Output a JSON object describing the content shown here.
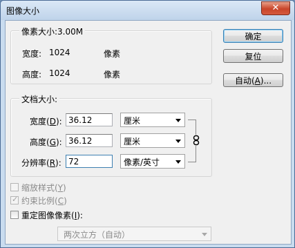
{
  "window": {
    "title": "图像大小",
    "close_symbol": "✕"
  },
  "pixel_dimensions": {
    "legend": "像素大小:3.00M",
    "width_label": "宽度:",
    "width_value": "1024",
    "width_unit": "像素",
    "height_label": "高度:",
    "height_value": "1024",
    "height_unit": "像素"
  },
  "buttons": {
    "ok": "确定",
    "reset": "复位",
    "auto_prefix": "自动(",
    "auto_key": "A",
    "auto_suffix": ")..."
  },
  "document_size": {
    "legend": "文档大小:",
    "width": {
      "label_prefix": "宽度(",
      "key": "D",
      "label_suffix": "):",
      "value": "36.12",
      "unit": "厘米"
    },
    "height": {
      "label_prefix": "高度(",
      "key": "G",
      "label_suffix": "):",
      "value": "36.12",
      "unit": "厘米"
    },
    "resolution": {
      "label_prefix": "分辨率(",
      "key": "R",
      "label_suffix": "):",
      "value": "72",
      "unit": "像素/英寸"
    }
  },
  "options": {
    "scale_styles": {
      "prefix": "缩放样式(",
      "key": "Y",
      "suffix": ")",
      "checked": false,
      "enabled": false
    },
    "constrain": {
      "prefix": "约束比例(",
      "key": "C",
      "suffix": ")",
      "checked": true,
      "enabled": false
    },
    "resample": {
      "prefix": "重定图像像素(",
      "key": "I",
      "suffix": "):",
      "checked": false,
      "enabled": true
    },
    "resample_method": "两次立方（自动）"
  }
}
